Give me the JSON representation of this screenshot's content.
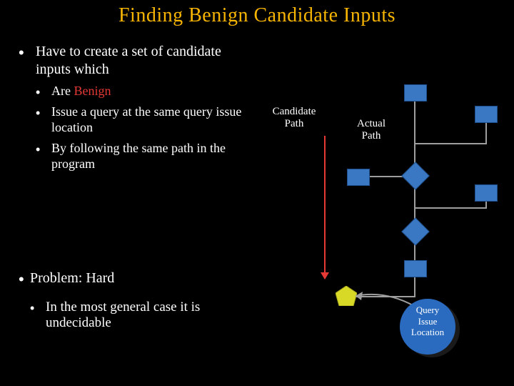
{
  "title": "Finding Benign Candidate Inputs",
  "main_bullet": "Have to create a set of candidate inputs which",
  "subs": {
    "a_pre": "Are ",
    "a_hl": "Benign",
    "b": "Issue a query at the same query issue location",
    "c": "By following the same path in the program"
  },
  "problem": "Problem: Hard",
  "problem_sub": "In the most general case it is undecidable",
  "labels": {
    "candidate": "Candidate\nPath",
    "actual": "Actual\nPath"
  },
  "qil": "Query\nIssue\nLocation"
}
